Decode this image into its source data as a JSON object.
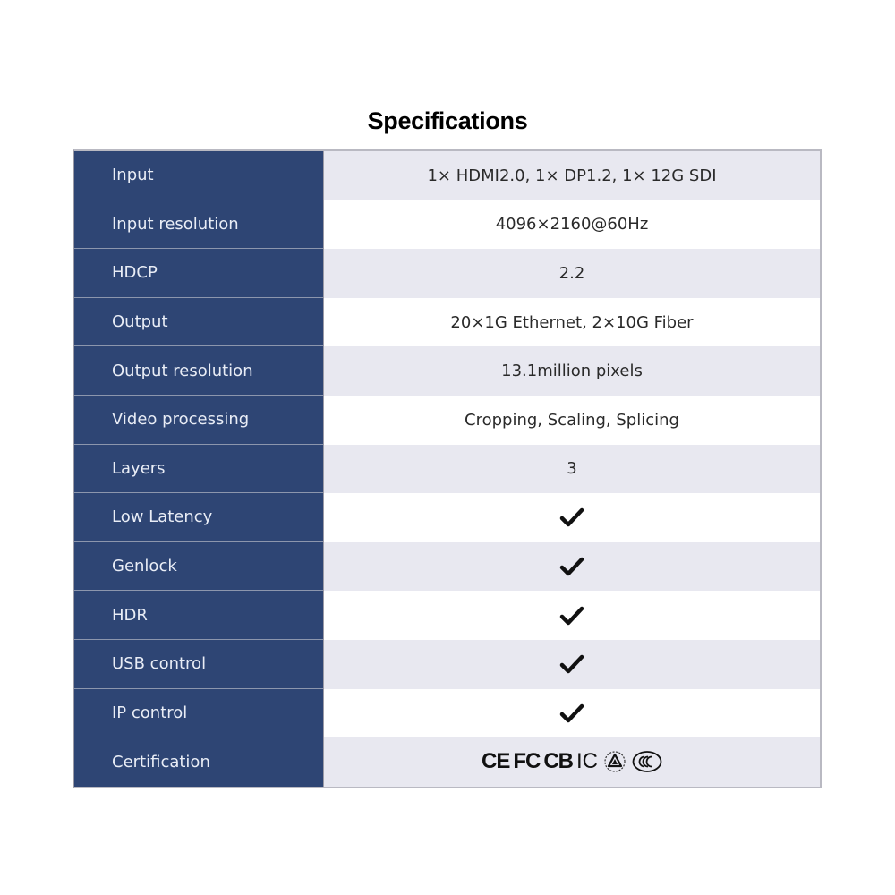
{
  "title": "Specifications",
  "rows": [
    {
      "label": "Input",
      "value": "1× HDMI2.0, 1× DP1.2, 1× 12G SDI",
      "type": "text"
    },
    {
      "label": "Input resolution",
      "value": "4096×2160@60Hz",
      "type": "text"
    },
    {
      "label": "HDCP",
      "value": "2.2",
      "type": "text"
    },
    {
      "label": "Output",
      "value": "20×1G Ethernet, 2×10G Fiber",
      "type": "text"
    },
    {
      "label": "Output resolution",
      "value": "13.1million pixels",
      "type": "text"
    },
    {
      "label": "Video processing",
      "value": "Cropping, Scaling, Splicing",
      "type": "text"
    },
    {
      "label": "Layers",
      "value": "3",
      "type": "text"
    },
    {
      "label": "Low Latency",
      "value": "check-icon",
      "type": "check"
    },
    {
      "label": "Genlock",
      "value": "check-icon",
      "type": "check"
    },
    {
      "label": "HDR",
      "value": "check-icon",
      "type": "check"
    },
    {
      "label": "USB control",
      "value": "check-icon",
      "type": "check"
    },
    {
      "label": "IP control",
      "value": "check-icon",
      "type": "check"
    },
    {
      "label": "Certification",
      "value": "cert-logos",
      "type": "certs"
    }
  ],
  "certifications": {
    "ce": "CE",
    "fcc": "FC",
    "cb": "CB",
    "ic": "IC",
    "icons": [
      "ce-mark-icon",
      "fcc-mark-icon",
      "cb-mark-icon",
      "ic-mark-icon",
      "triangle-cert-icon",
      "ccc-mark-icon"
    ]
  },
  "colors": {
    "label_bg": "#2e4574",
    "label_text": "#e9edf6",
    "stripe_bg": "#e8e8f0",
    "value_text": "#2a2a2a"
  }
}
